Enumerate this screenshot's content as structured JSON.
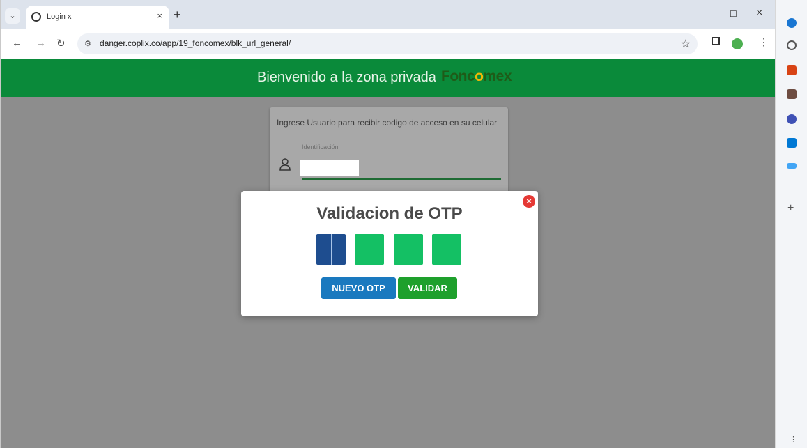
{
  "browser": {
    "tab_title": "Login x",
    "tab_close": "×",
    "new_tab": "+",
    "url": "danger.coplix.co/app/19_foncomex/blk_url_general/",
    "window_controls": {
      "minimize": "–",
      "maximize": "☐",
      "close": "×"
    }
  },
  "page": {
    "welcome": "Bienvenido a la zona privada",
    "logo_text": {
      "a": "Fonc",
      "o": "o",
      "b": "mex"
    },
    "login_prompt": "Ingrese Usuario para recibir codigo de acceso en su celular",
    "id_label": "Identificación"
  },
  "modal": {
    "title": "Validacion de OTP",
    "close": "×",
    "new_otp": "NUEVO OTP",
    "validate": "VALIDAR"
  },
  "colors": {
    "header_green": "#0a8a3a",
    "otp_active": "#1e4d8f",
    "otp_box": "#14c064",
    "btn_new_otp": "#1a79bf",
    "btn_validar": "#1ea02c",
    "close_red": "#e53935"
  },
  "icons": [
    "tab-dropdown-icon",
    "site-favicon-icon",
    "back-icon",
    "forward-icon",
    "reload-icon",
    "site-info-icon",
    "bookmark-star-icon",
    "side-panel-icon",
    "profile-avatar-icon",
    "menu-icon",
    "user-icon",
    "close-icon",
    "copilot-icon",
    "search-icon",
    "shopping-icon",
    "games-icon",
    "office-icon",
    "outlook-icon",
    "tools-icon",
    "plus-icon"
  ]
}
